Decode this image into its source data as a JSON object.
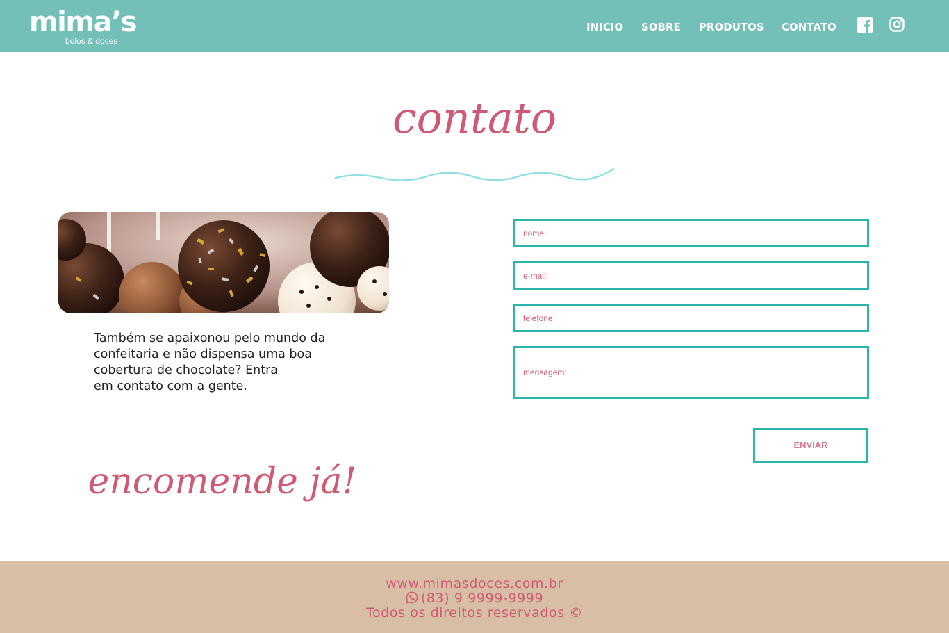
{
  "header": {
    "logo_text": "mima’s",
    "logo_subtitle": "bolos & doces",
    "nav": [
      "INICIO",
      "SOBRE",
      "PRODUTOS",
      "CONTATO"
    ],
    "social_icons": [
      "facebook-icon",
      "instagram-icon"
    ]
  },
  "page_title": "contato",
  "intro": {
    "lines": [
      "Também se apaixonou pelo mundo da",
      "confeitaria e não dispensa uma boa",
      "cobertura de chocolate? Entra",
      "em contato com a gente."
    ]
  },
  "cta_text": "encomende já!",
  "form": {
    "name_placeholder": "nome:",
    "email_placeholder": "e-mail:",
    "phone_placeholder": "telefone:",
    "message_placeholder": "mensagem:",
    "submit_label": "ENVIAR"
  },
  "footer": {
    "website": "www.mimasdoces.com.br",
    "phone": "(83) 9 9999-9999",
    "rights": "Todos os direitos reservados ©"
  },
  "colors": {
    "header_bg": "#73c0b8",
    "accent_pink": "#cf5a76",
    "field_border": "#2bb5ad",
    "footer_bg": "#d9bea6",
    "wave": "#8ee0e3"
  }
}
